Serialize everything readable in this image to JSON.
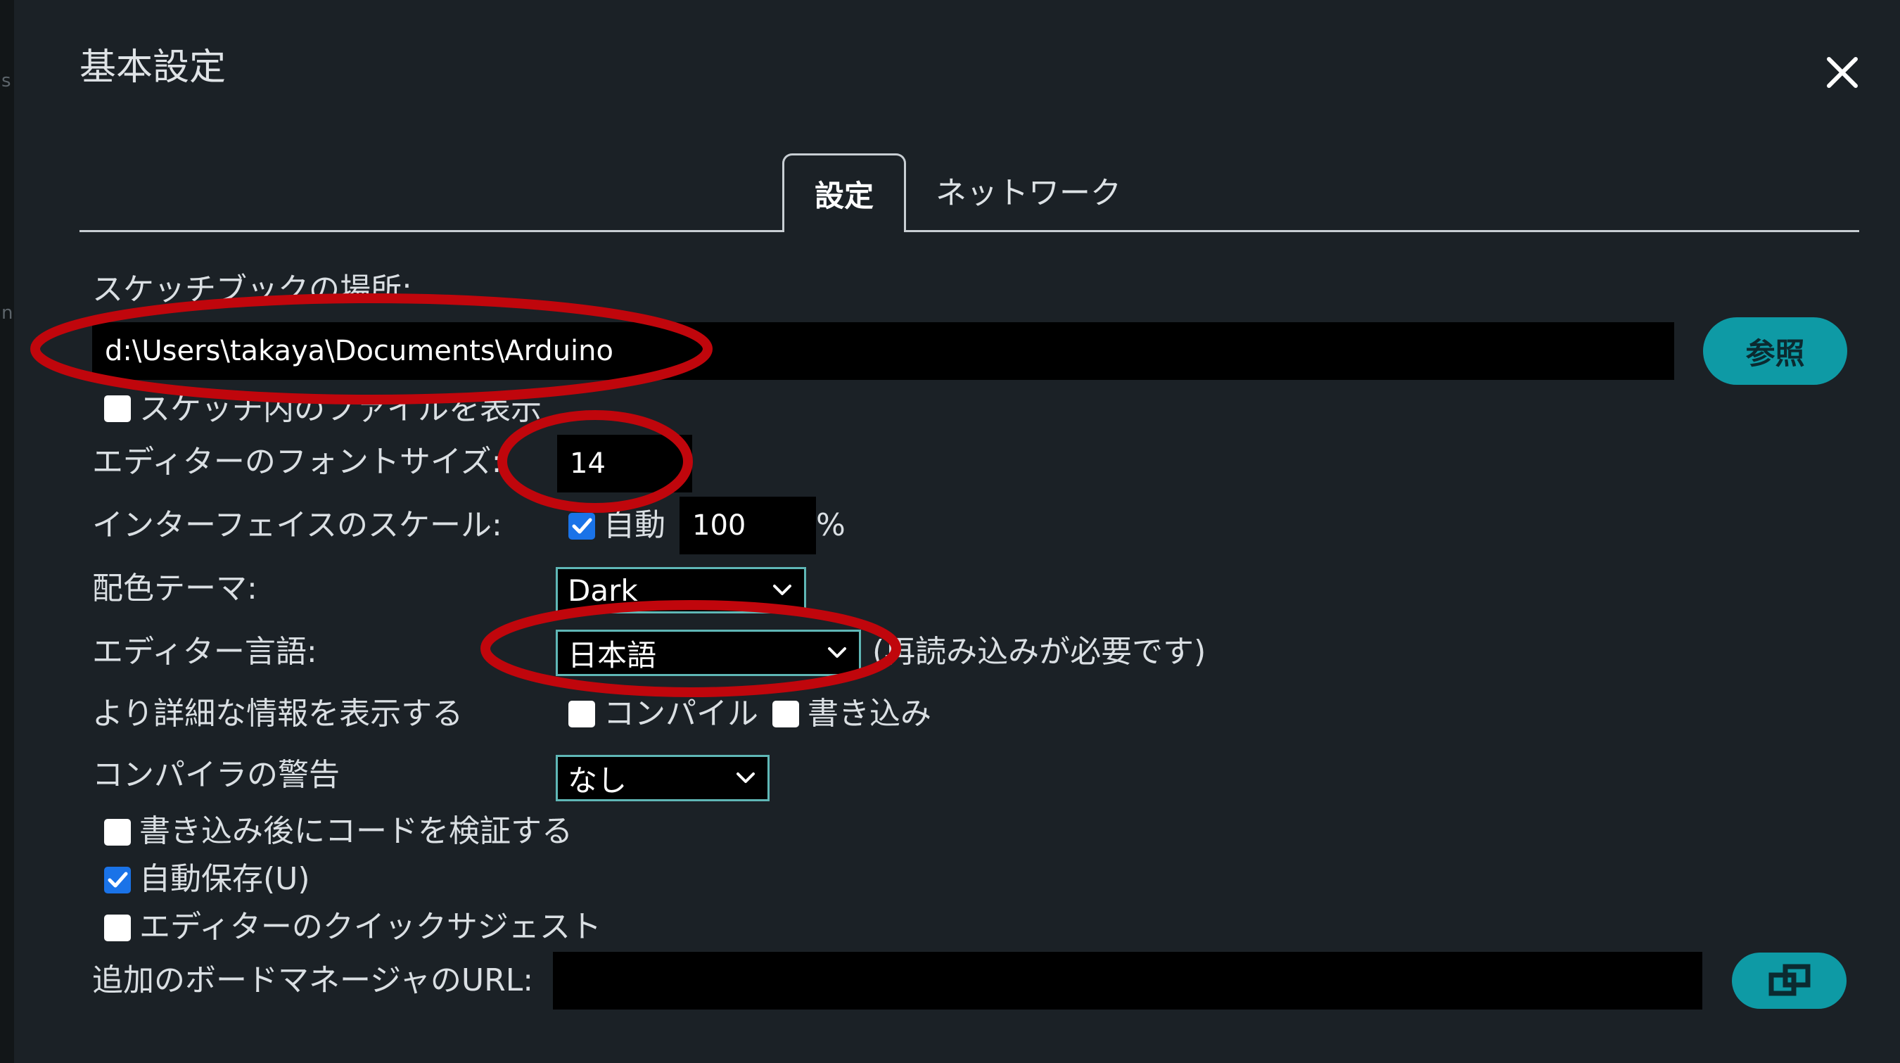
{
  "left_strip": {
    "chars": [
      "s",
      "n"
    ]
  },
  "dialog": {
    "title": "基本設定"
  },
  "tabs": [
    {
      "label": "設定",
      "active": true
    },
    {
      "label": "ネットワーク",
      "active": false
    }
  ],
  "settings": {
    "sketchbook_label": "スケッチブックの場所:",
    "sketchbook_path": "d:\\Users\\takaya\\Documents\\Arduino",
    "browse_button": "参照",
    "show_files_label": "スケッチ内のファイルを表示",
    "font_size_label": "エディターのフォントサイズ:",
    "font_size_value": "14",
    "scale_label": "インターフェイスのスケール:",
    "scale_auto_label": "自動",
    "scale_value": "100",
    "scale_unit": "%",
    "theme_label": "配色テーマ:",
    "theme_value": "Dark",
    "language_label": "エディター言語:",
    "language_value": "日本語",
    "language_note": "(再読み込みが必要です)",
    "verbose_label": "より詳細な情報を表示する",
    "verbose_compile": "コンパイル",
    "verbose_upload": "書き込み",
    "warnings_label": "コンパイラの警告",
    "warnings_value": "なし",
    "verify_label": "書き込み後にコードを検証する",
    "autosave_label": "自動保存(U)",
    "quick_suggest_label": "エディターのクイックサジェスト",
    "board_urls_label": "追加のボードマネージャのURL:",
    "board_urls_value": ""
  },
  "colors": {
    "background": "#1b2126",
    "accent_teal": "#0e9aa5",
    "annotation_red": "#c0060c",
    "checkbox_checked": "#1a73e8"
  }
}
